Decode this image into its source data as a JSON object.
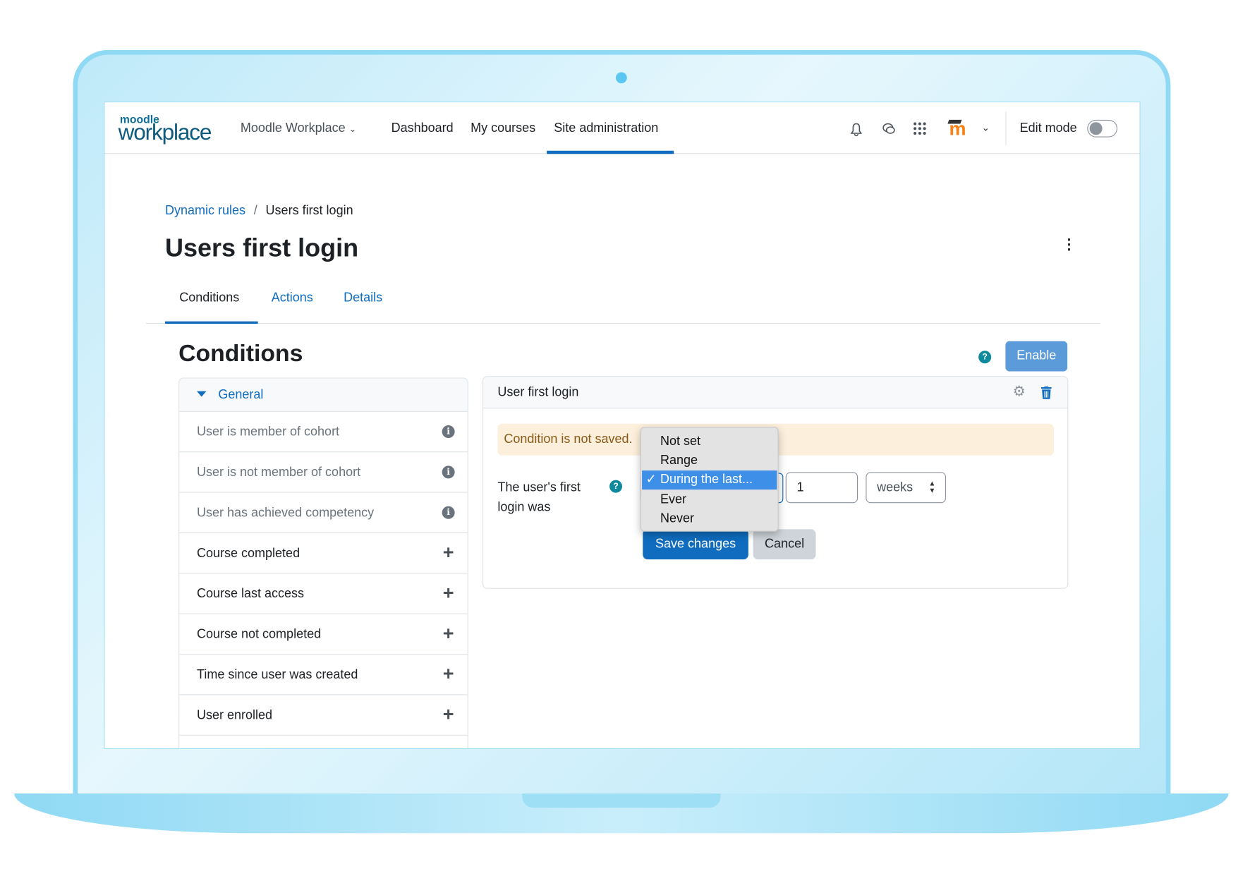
{
  "nav": {
    "logo_small": "moodle",
    "logo_large": "workplace",
    "menu": "Moodle Workplace",
    "links": [
      "Dashboard",
      "My courses",
      "Site administration"
    ],
    "active_link": "Site administration",
    "edit_mode_label": "Edit mode",
    "edit_mode_on": false
  },
  "breadcrumb": {
    "parent": "Dynamic rules",
    "separator": "/",
    "current": "Users first login"
  },
  "page_title": "Users first login",
  "tabs": [
    {
      "label": "Conditions",
      "active": true
    },
    {
      "label": "Actions"
    },
    {
      "label": "Details"
    }
  ],
  "section": {
    "heading": "Conditions",
    "enable_label": "Enable"
  },
  "conditions_list": {
    "group": "General",
    "items": [
      {
        "label": "User is member of cohort",
        "icon": "info-icon",
        "disabled": true
      },
      {
        "label": "User is not member of cohort",
        "icon": "info-icon",
        "disabled": true
      },
      {
        "label": "User has achieved competency",
        "icon": "info-icon",
        "disabled": true
      },
      {
        "label": "Course completed",
        "icon": "plus-icon"
      },
      {
        "label": "Course last access",
        "icon": "plus-icon"
      },
      {
        "label": "Course not completed",
        "icon": "plus-icon"
      },
      {
        "label": "Time since user was created",
        "icon": "plus-icon"
      },
      {
        "label": "User enrolled",
        "icon": "plus-icon"
      }
    ]
  },
  "condition_card": {
    "title": "User first login",
    "alert": "Condition is not saved.",
    "field_label_1": "The user's first",
    "field_label_2": "login was",
    "dropdown_options": [
      "Not set",
      "Range",
      "During the last...",
      "Ever",
      "Never"
    ],
    "selected_option": "During the last...",
    "check": "✓",
    "amount": "1",
    "unit": "weeks",
    "save_label": "Save changes",
    "cancel_label": "Cancel"
  },
  "colors": {
    "primary": "#0f6cbf",
    "alert_bg": "#fcefdc",
    "alert_text": "#8a5a17",
    "laptop": "#8fd9f4"
  }
}
